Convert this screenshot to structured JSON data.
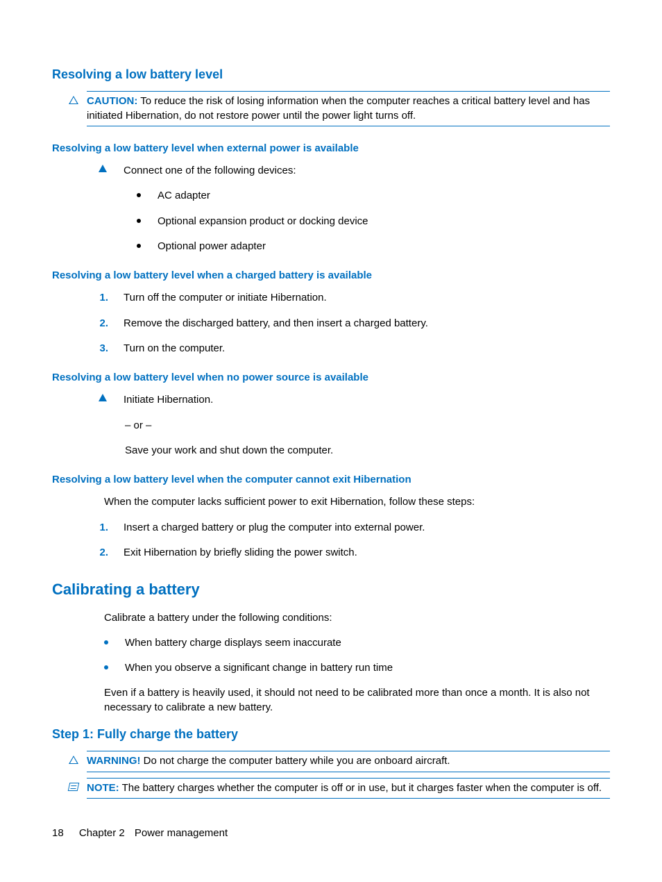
{
  "section1": {
    "title": "Resolving a low battery level",
    "caution_label": "CAUTION:",
    "caution_text": "To reduce the risk of losing information when the computer reaches a critical battery level and has initiated Hibernation, do not restore power until the power light turns off.",
    "sub_a": {
      "title": "Resolving a low battery level when external power is available",
      "lead": "Connect one of the following devices:",
      "items": [
        "AC adapter",
        "Optional expansion product or docking device",
        "Optional power adapter"
      ]
    },
    "sub_b": {
      "title": "Resolving a low battery level when a charged battery is available",
      "steps": [
        "Turn off the computer or initiate Hibernation.",
        "Remove the discharged battery, and then insert a charged battery.",
        "Turn on the computer."
      ]
    },
    "sub_c": {
      "title": "Resolving a low battery level when no power source is available",
      "line1": "Initiate Hibernation.",
      "or": "– or –",
      "line2": "Save your work and shut down the computer."
    },
    "sub_d": {
      "title": "Resolving a low battery level when the computer cannot exit Hibernation",
      "intro": "When the computer lacks sufficient power to exit Hibernation, follow these steps:",
      "steps": [
        "Insert a charged battery or plug the computer into external power.",
        "Exit Hibernation by briefly sliding the power switch."
      ]
    }
  },
  "section2": {
    "title": "Calibrating a battery",
    "intro": "Calibrate a battery under the following conditions:",
    "bullets": [
      "When battery charge displays seem inaccurate",
      "When you observe a significant change in battery run time"
    ],
    "tail": "Even if a battery is heavily used, it should not need to be calibrated more than once a month. It is also not necessary to calibrate a new battery.",
    "step1": {
      "title": "Step 1: Fully charge the battery",
      "warning_label": "WARNING!",
      "warning_text": "Do not charge the computer battery while you are onboard aircraft.",
      "note_label": "NOTE:",
      "note_text": "The battery charges whether the computer is off or in use, but it charges faster when the computer is off."
    }
  },
  "footer": {
    "page": "18",
    "chapter": "Chapter 2",
    "title": "Power management"
  },
  "nums": {
    "n1": "1.",
    "n2": "2.",
    "n3": "3."
  }
}
